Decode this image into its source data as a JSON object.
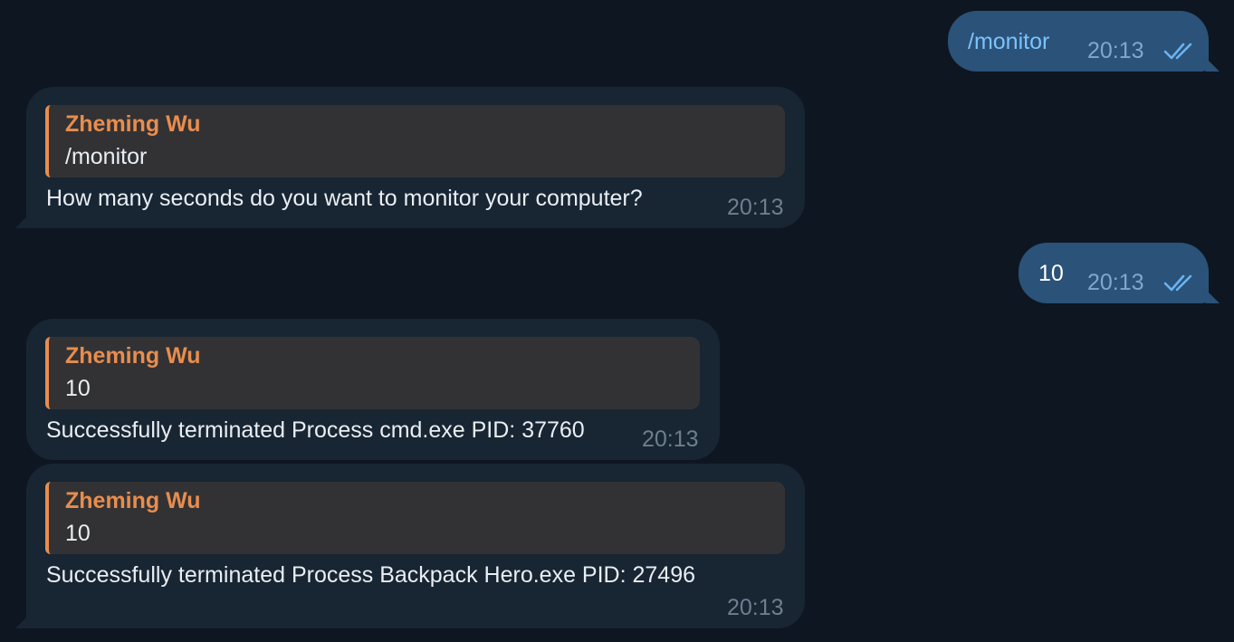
{
  "messages": [
    {
      "direction": "outgoing",
      "text": "/monitor",
      "time": "20:13",
      "status_icon": "double-check-icon"
    },
    {
      "direction": "incoming",
      "reply_to": {
        "sender": "Zheming Wu",
        "text": "/monitor"
      },
      "text": "How many seconds do you want to monitor your computer?",
      "time": "20:13"
    },
    {
      "direction": "outgoing",
      "text": "10",
      "time": "20:13",
      "status_icon": "double-check-icon"
    },
    {
      "direction": "incoming",
      "reply_to": {
        "sender": "Zheming Wu",
        "text": "10"
      },
      "text": "Successfully terminated Process cmd.exe PID: 37760",
      "time": "20:13"
    },
    {
      "direction": "incoming",
      "reply_to": {
        "sender": "Zheming Wu",
        "text": "10"
      },
      "text": "Successfully terminated Process Backpack Hero.exe PID: 27496",
      "time": "20:13"
    }
  ],
  "colors": {
    "background": "#0e1621",
    "outgoing_bubble": "#2b5278",
    "incoming_bubble": "#182533",
    "reply_accent": "#e88d4d",
    "check_color": "#6ab3f3"
  }
}
